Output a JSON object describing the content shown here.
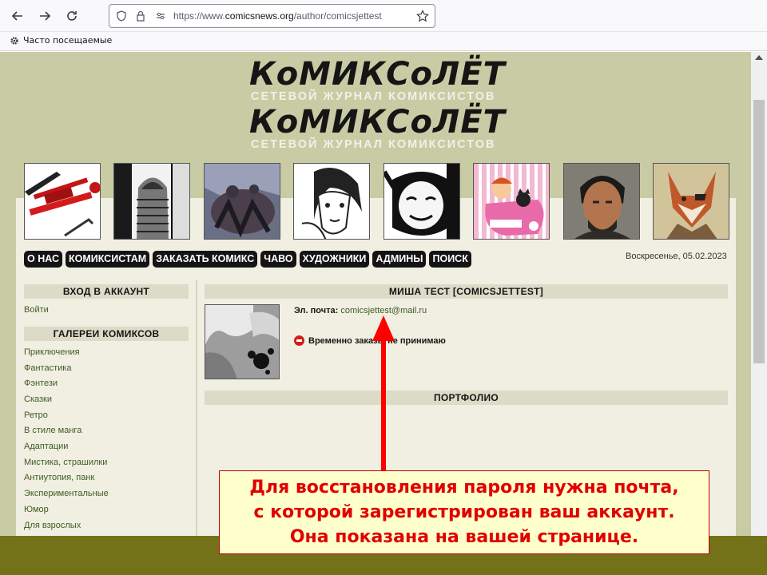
{
  "browser": {
    "url_prefix": "https://www.",
    "url_domain": "comicsnews.org",
    "url_path": "/author/comicsjettest",
    "bookmarks_item": "Часто посещаемые"
  },
  "site": {
    "logo_title": "КоМИКСоЛЁТ",
    "logo_subtitle": "СЕТЕВОЙ ЖУРНАЛ КОМИКСИСТОВ",
    "menu": [
      "О НАС",
      "КОМИКСИСТАМ",
      "ЗАКАЗАТЬ КОМИКС",
      "ЧАВО",
      "ХУДОЖНИКИ",
      "АДМИНЫ",
      "ПОИСК"
    ],
    "date": "Воскресенье, 05.02.2023"
  },
  "sidebar": {
    "login_header": "ВХОД В АККАУНТ",
    "login_link": "Войти",
    "galleries_header": "ГАЛЕРЕИ КОМИКСОВ",
    "galleries": [
      "Приключения",
      "Фантастика",
      "Фэнтези",
      "Сказки",
      "Ретро",
      "В стиле манга",
      "Адаптации",
      "Мистика, страшилки",
      "Антиутопия, панк",
      "Экспериментальные",
      "Юмор",
      "Для взрослых"
    ]
  },
  "profile": {
    "title": "МИША ТЕСТ [COMICSJETTEST]",
    "email_label": "Эл. почта:",
    "email": "comicsjettest@mail.ru",
    "status": "Временно заказы не принимаю",
    "portfolio_header": "ПОРТФОЛИО"
  },
  "callout": {
    "line1": "Для восстановления пароля нужна почта,",
    "line2": "с которой зарегистрирован ваш аккаунт.",
    "line3": "Она показана на вашей странице."
  },
  "colors": {
    "page_bg": "#c9cba4",
    "content_bg": "#f0efe2",
    "link": "#3f5b23",
    "footer_band": "#737218",
    "callout_text": "#e00000",
    "arrow": "#ff0000"
  }
}
